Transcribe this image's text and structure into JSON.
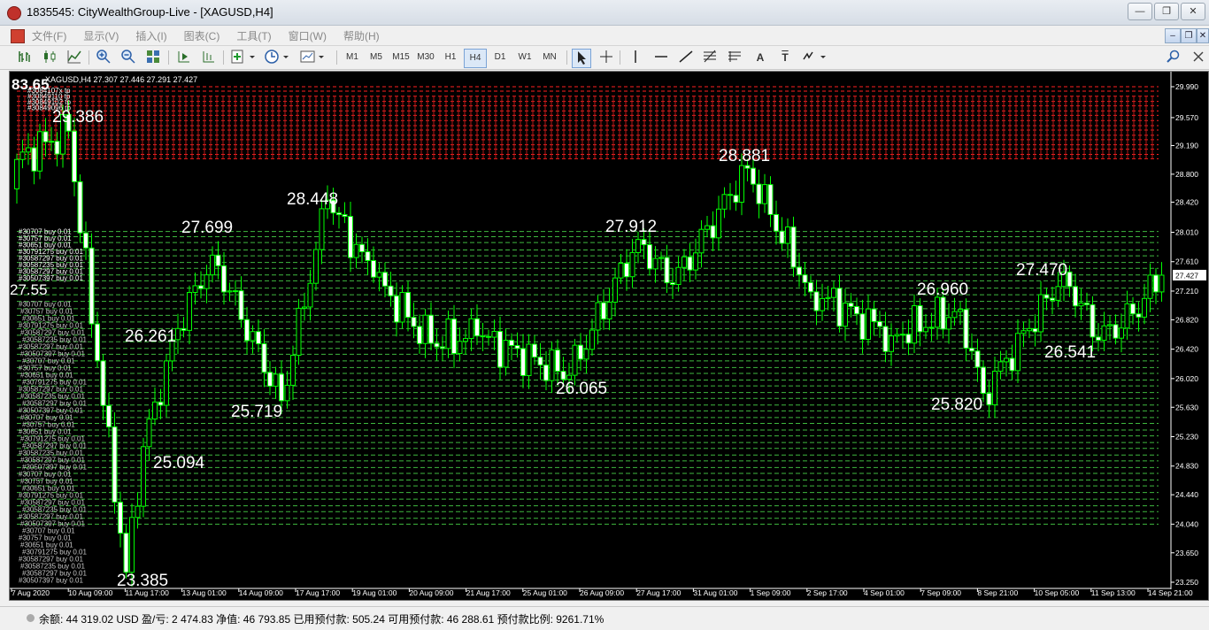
{
  "window": {
    "title": "1835545: CityWealthGroup-Live - [XAGUSD,H4]",
    "buttons": [
      "—",
      "❐",
      "✕"
    ]
  },
  "menu": {
    "items": [
      "文件(F)",
      "显示(V)",
      "插入(I)",
      "图表(C)",
      "工具(T)",
      "窗口(W)",
      "帮助(H)"
    ],
    "mdi_buttons": [
      "–",
      "❐",
      "✕"
    ]
  },
  "toolbar": {
    "timeframes": [
      "M1",
      "M5",
      "M15",
      "M30",
      "H1",
      "H4",
      "D1",
      "W1",
      "MN"
    ],
    "active_timeframe": "H4",
    "icons": [
      "bar-chart",
      "candlestick-chart",
      "line-chart",
      "zoom-in",
      "zoom-out",
      "tile-windows",
      "autoscroll",
      "chart-shift",
      "new-order",
      "history-center",
      "templates",
      "cursor",
      "crosshair",
      "vertical-line",
      "horizontal-line",
      "trendline",
      "fibonacci",
      "gann",
      "text",
      "text-label",
      "arrows",
      "search",
      "close"
    ],
    "text_tool_label": "A",
    "text_label_tool_label": "T"
  },
  "chart": {
    "symbol_info": "XAGUSD,H4  27.307 27.446 27.291 27.427",
    "corner_overlay": "83.65",
    "left_overlay": "27.55",
    "current_price": "27.427",
    "price_axis": [
      "29.990",
      "29.570",
      "29.190",
      "28.800",
      "28.420",
      "28.010",
      "27.610",
      "27.210",
      "26.820",
      "26.420",
      "26.020",
      "25.630",
      "25.230",
      "24.830",
      "24.440",
      "24.040",
      "23.650",
      "23.250"
    ],
    "time_axis": [
      "7 Aug 2020",
      "10 Aug 09:00",
      "11 Aug 17:00",
      "13 Aug 01:00",
      "14 Aug 09:00",
      "17 Aug 17:00",
      "19 Aug 01:00",
      "20 Aug 09:00",
      "21 Aug 17:00",
      "25 Aug 01:00",
      "26 Aug 09:00",
      "27 Aug 17:00",
      "31 Aug 01:00",
      "1 Sep 09:00",
      "2 Sep 17:00",
      "4 Sep 01:00",
      "7 Sep 09:00",
      "8 Sep 21:00",
      "10 Sep 05:00",
      "11 Sep 13:00",
      "14 Sep 21:00"
    ],
    "swing_labels": [
      {
        "text": "29.386"
      },
      {
        "text": "28.448"
      },
      {
        "text": "27.699"
      },
      {
        "text": "26.261"
      },
      {
        "text": "25.719"
      },
      {
        "text": "25.094"
      },
      {
        "text": "23.385"
      },
      {
        "text": "27.912"
      },
      {
        "text": "26.065"
      },
      {
        "text": "28.881"
      },
      {
        "text": "26.960"
      },
      {
        "text": "25.820"
      },
      {
        "text": "27.470"
      },
      {
        "text": "26.541"
      }
    ],
    "sell_tp_levels": [
      29.99,
      29.93,
      29.86,
      29.79,
      29.73,
      29.66,
      29.6,
      29.53,
      29.46,
      29.4,
      29.33,
      29.27,
      29.2,
      29.14,
      29.07,
      29.01
    ],
    "buy_levels": [
      28.02,
      27.95,
      27.87,
      27.77,
      27.69,
      27.6,
      27.52,
      27.43,
      27.35,
      27.25,
      27.16,
      27.07,
      26.97,
      26.88,
      26.79,
      26.7,
      26.61,
      26.52,
      26.43,
      26.35,
      26.26,
      26.17,
      26.09,
      26.0,
      25.92,
      25.83,
      25.75,
      25.66,
      25.58,
      25.49,
      25.41,
      25.32,
      25.24,
      25.15,
      25.07,
      24.98,
      24.9,
      24.81,
      24.73,
      24.64,
      24.56,
      24.47,
      24.38,
      24.29,
      24.21,
      24.12,
      24.04
    ],
    "sell_label_sample": [
      "#3084107x tp",
      "#30849110 tp",
      "#30849102 tp",
      "#30849096 tp"
    ],
    "buy_label_sample": [
      "#30707 buy 0.01",
      "#30757 buy 0.01",
      "#30651 buy 0.01",
      "#30791275 buy 0.01",
      "#30587297 buy 0.01",
      "#30587235 buy 0.01",
      "#30587297 buy 0.01",
      "#30507397 buy 0.01"
    ],
    "colors": {
      "background": "#000000",
      "bull": "#000000",
      "bear": "#ffffff",
      "wick": "#00ff00",
      "sell_line": "#ff2020",
      "buy_line": "#3fb83f",
      "text": "#ffffff"
    }
  },
  "chart_data": {
    "type": "candlestick",
    "title": "XAGUSD,H4",
    "ohlc_header": {
      "open": 27.307,
      "high": 27.446,
      "low": 27.291,
      "close": 27.427
    },
    "ylim": [
      23.25,
      29.99
    ],
    "pivots": [
      {
        "i": 0,
        "p": 29.0
      },
      {
        "i": 9,
        "p": 29.386
      },
      {
        "i": 14,
        "p": 26.261
      },
      {
        "i": 19,
        "p": 23.385
      },
      {
        "i": 22,
        "p": 25.094
      },
      {
        "i": 28,
        "p": 26.7
      },
      {
        "i": 34,
        "p": 27.699
      },
      {
        "i": 46,
        "p": 25.719
      },
      {
        "i": 54,
        "p": 28.448
      },
      {
        "i": 62,
        "p": 27.4
      },
      {
        "i": 72,
        "p": 26.5
      },
      {
        "i": 80,
        "p": 26.6
      },
      {
        "i": 96,
        "p": 26.065
      },
      {
        "i": 108,
        "p": 27.912
      },
      {
        "i": 114,
        "p": 27.3
      },
      {
        "i": 127,
        "p": 28.881
      },
      {
        "i": 138,
        "p": 27.2
      },
      {
        "i": 146,
        "p": 26.9
      },
      {
        "i": 152,
        "p": 26.6
      },
      {
        "i": 164,
        "p": 26.96
      },
      {
        "i": 168,
        "p": 25.82
      },
      {
        "i": 176,
        "p": 26.7
      },
      {
        "i": 182,
        "p": 27.47
      },
      {
        "i": 188,
        "p": 26.541
      },
      {
        "i": 194,
        "p": 26.9
      },
      {
        "i": 199,
        "p": 27.427
      }
    ]
  },
  "status": {
    "text": "余额: 44 319.02 USD   盈/亏: 2 474.83   净值: 46 793.85   已用预付款: 505.24   可用预付款: 46 288.61   预付款比例: 9261.71%"
  }
}
